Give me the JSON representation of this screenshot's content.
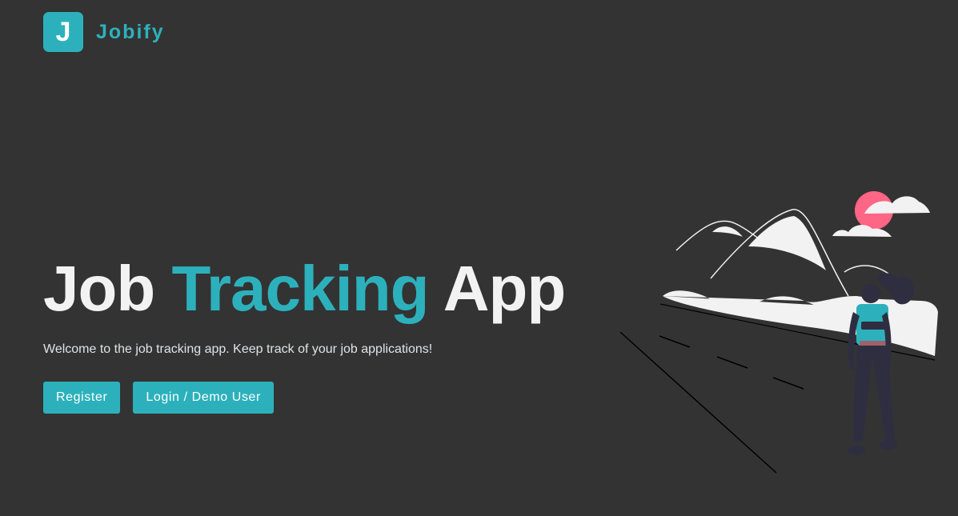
{
  "navbar": {
    "logo_letter": "J",
    "brand_name": "Jobify"
  },
  "hero": {
    "title_part1": "Job ",
    "title_accent": "Tracking",
    "title_part2": " App",
    "subtitle": "Welcome to the job tracking app. Keep track of your job applications!",
    "register_label": "Register",
    "login_label": "Login / Demo User"
  },
  "colors": {
    "background": "#333333",
    "accent": "#2cb1bc",
    "text": "#f2f2f2",
    "sun": "#ff6584",
    "figure_dark": "#2f2e41"
  },
  "icons": {
    "logo": "letter-j-logo",
    "illustration": "hiker-mountains-illustration"
  }
}
